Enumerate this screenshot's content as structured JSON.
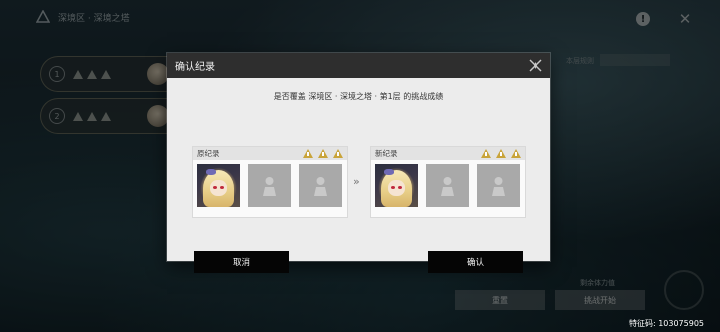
{
  "header": {
    "breadcrumb": "深境区 · 深境之塔"
  },
  "background": {
    "row1_index": "1",
    "row2_index": "2",
    "right_label": "本层规则",
    "bottom_text": "剩余体力值",
    "btn_left": "重置",
    "btn_right": "挑战开始",
    "uid": "特征码: 103075905"
  },
  "modal": {
    "title": "确认纪录",
    "question": "是否覆盖 深境区 · 深境之塔 · 第1层 的挑战成绩",
    "old_record_label": "原纪录",
    "new_record_label": "新纪录",
    "arrow": "»",
    "cancel_label": "取消",
    "confirm_label": "确认"
  },
  "colors": {
    "accent_star": "#c9a43a",
    "button_bg": "#050505",
    "modal_bg": "#ececec",
    "header_bg": "#2e2e2e"
  },
  "icons": {
    "close": "close-icon",
    "info": "info-icon",
    "star": "warning-triangle-icon",
    "empty_slot": "person-icon"
  }
}
